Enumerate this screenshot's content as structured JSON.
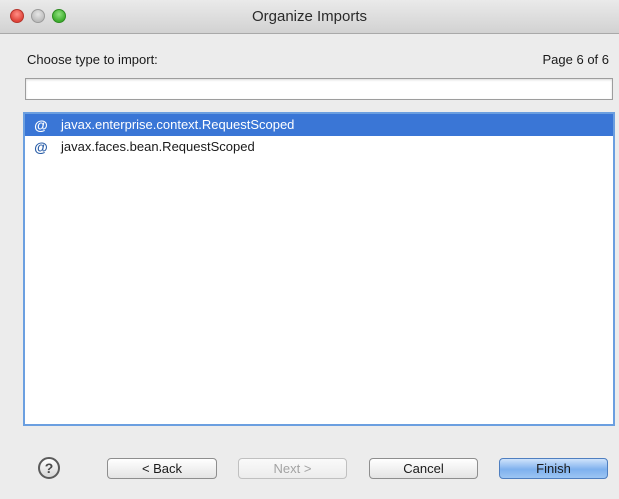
{
  "window": {
    "title": "Organize Imports"
  },
  "dialog": {
    "prompt": "Choose type to import:",
    "page_indicator": "Page 6 of 6",
    "filter": {
      "value": "",
      "placeholder": ""
    },
    "items": [
      {
        "icon": "annotation-icon",
        "label": "javax.enterprise.context.RequestScoped",
        "selected": true
      },
      {
        "icon": "annotation-icon",
        "label": "javax.faces.bean.RequestScoped",
        "selected": false
      }
    ]
  },
  "buttons": {
    "help": "?",
    "back": "< Back",
    "next": "Next >",
    "cancel": "Cancel",
    "finish": "Finish"
  },
  "colors": {
    "selection": "#3a76d6",
    "list_border": "#6b9fe0",
    "default_button": "#7fb1ee"
  }
}
